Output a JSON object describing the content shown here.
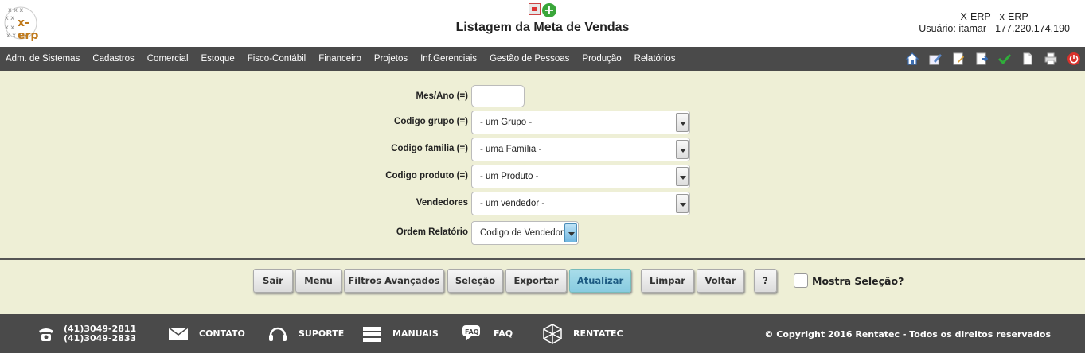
{
  "header": {
    "logo_text": "x-erp",
    "title": "Listagem da Meta de Vendas",
    "system": "X-ERP - x-ERP",
    "user": "Usuário: itamar - 177.220.174.190",
    "icons": [
      "pdf-icon",
      "add-icon"
    ]
  },
  "menu": {
    "items": [
      "Adm. de Sistemas",
      "Cadastros",
      "Comercial",
      "Estoque",
      "Fisco-Contábil",
      "Financeiro",
      "Projetos",
      "Inf.Gerenciais",
      "Gestão de Pessoas",
      "Produção",
      "Relatórios"
    ],
    "icons": [
      "home-icon",
      "edit-icon",
      "document-edit-icon",
      "export-icon",
      "check-icon",
      "new-document-icon",
      "print-icon",
      "power-icon"
    ]
  },
  "form": {
    "mes_ano": {
      "label": "Mes/Ano (=)",
      "value": ""
    },
    "grupo": {
      "label": "Codigo grupo (=)",
      "value": "- um Grupo -"
    },
    "familia": {
      "label": "Codigo familia (=)",
      "value": "- uma Família -"
    },
    "produto": {
      "label": "Codigo produto (=)",
      "value": "- um Produto -"
    },
    "vendedores": {
      "label": "Vendedores",
      "value": "- um vendedor -"
    },
    "ordem": {
      "label": "Ordem Relatório",
      "value": "Codigo de Vendedor"
    }
  },
  "buttons": {
    "sair": "Sair",
    "menu": "Menu",
    "filtros": "Filtros Avançados",
    "selecao": "Seleção",
    "exportar": "Exportar",
    "atualizar": "Atualizar",
    "limpar": "Limpar",
    "voltar": "Voltar",
    "help": "?",
    "mostra_selecao": "Mostra Seleção?"
  },
  "footer": {
    "phone1": "(41)3049-2811",
    "phone2": "(41)3049-2833",
    "contato": "CONTATO",
    "suporte": "SUPORTE",
    "manuais": "MANUAIS",
    "faq": "FAQ",
    "rentatec": "RENTATEC",
    "copyright": "© Copyright 2016 Rentatec - Todos os direitos reservados"
  },
  "colors": {
    "background": "#eeefd6",
    "bar": "#4a4a4a",
    "active_button": "#9fd7e6"
  }
}
